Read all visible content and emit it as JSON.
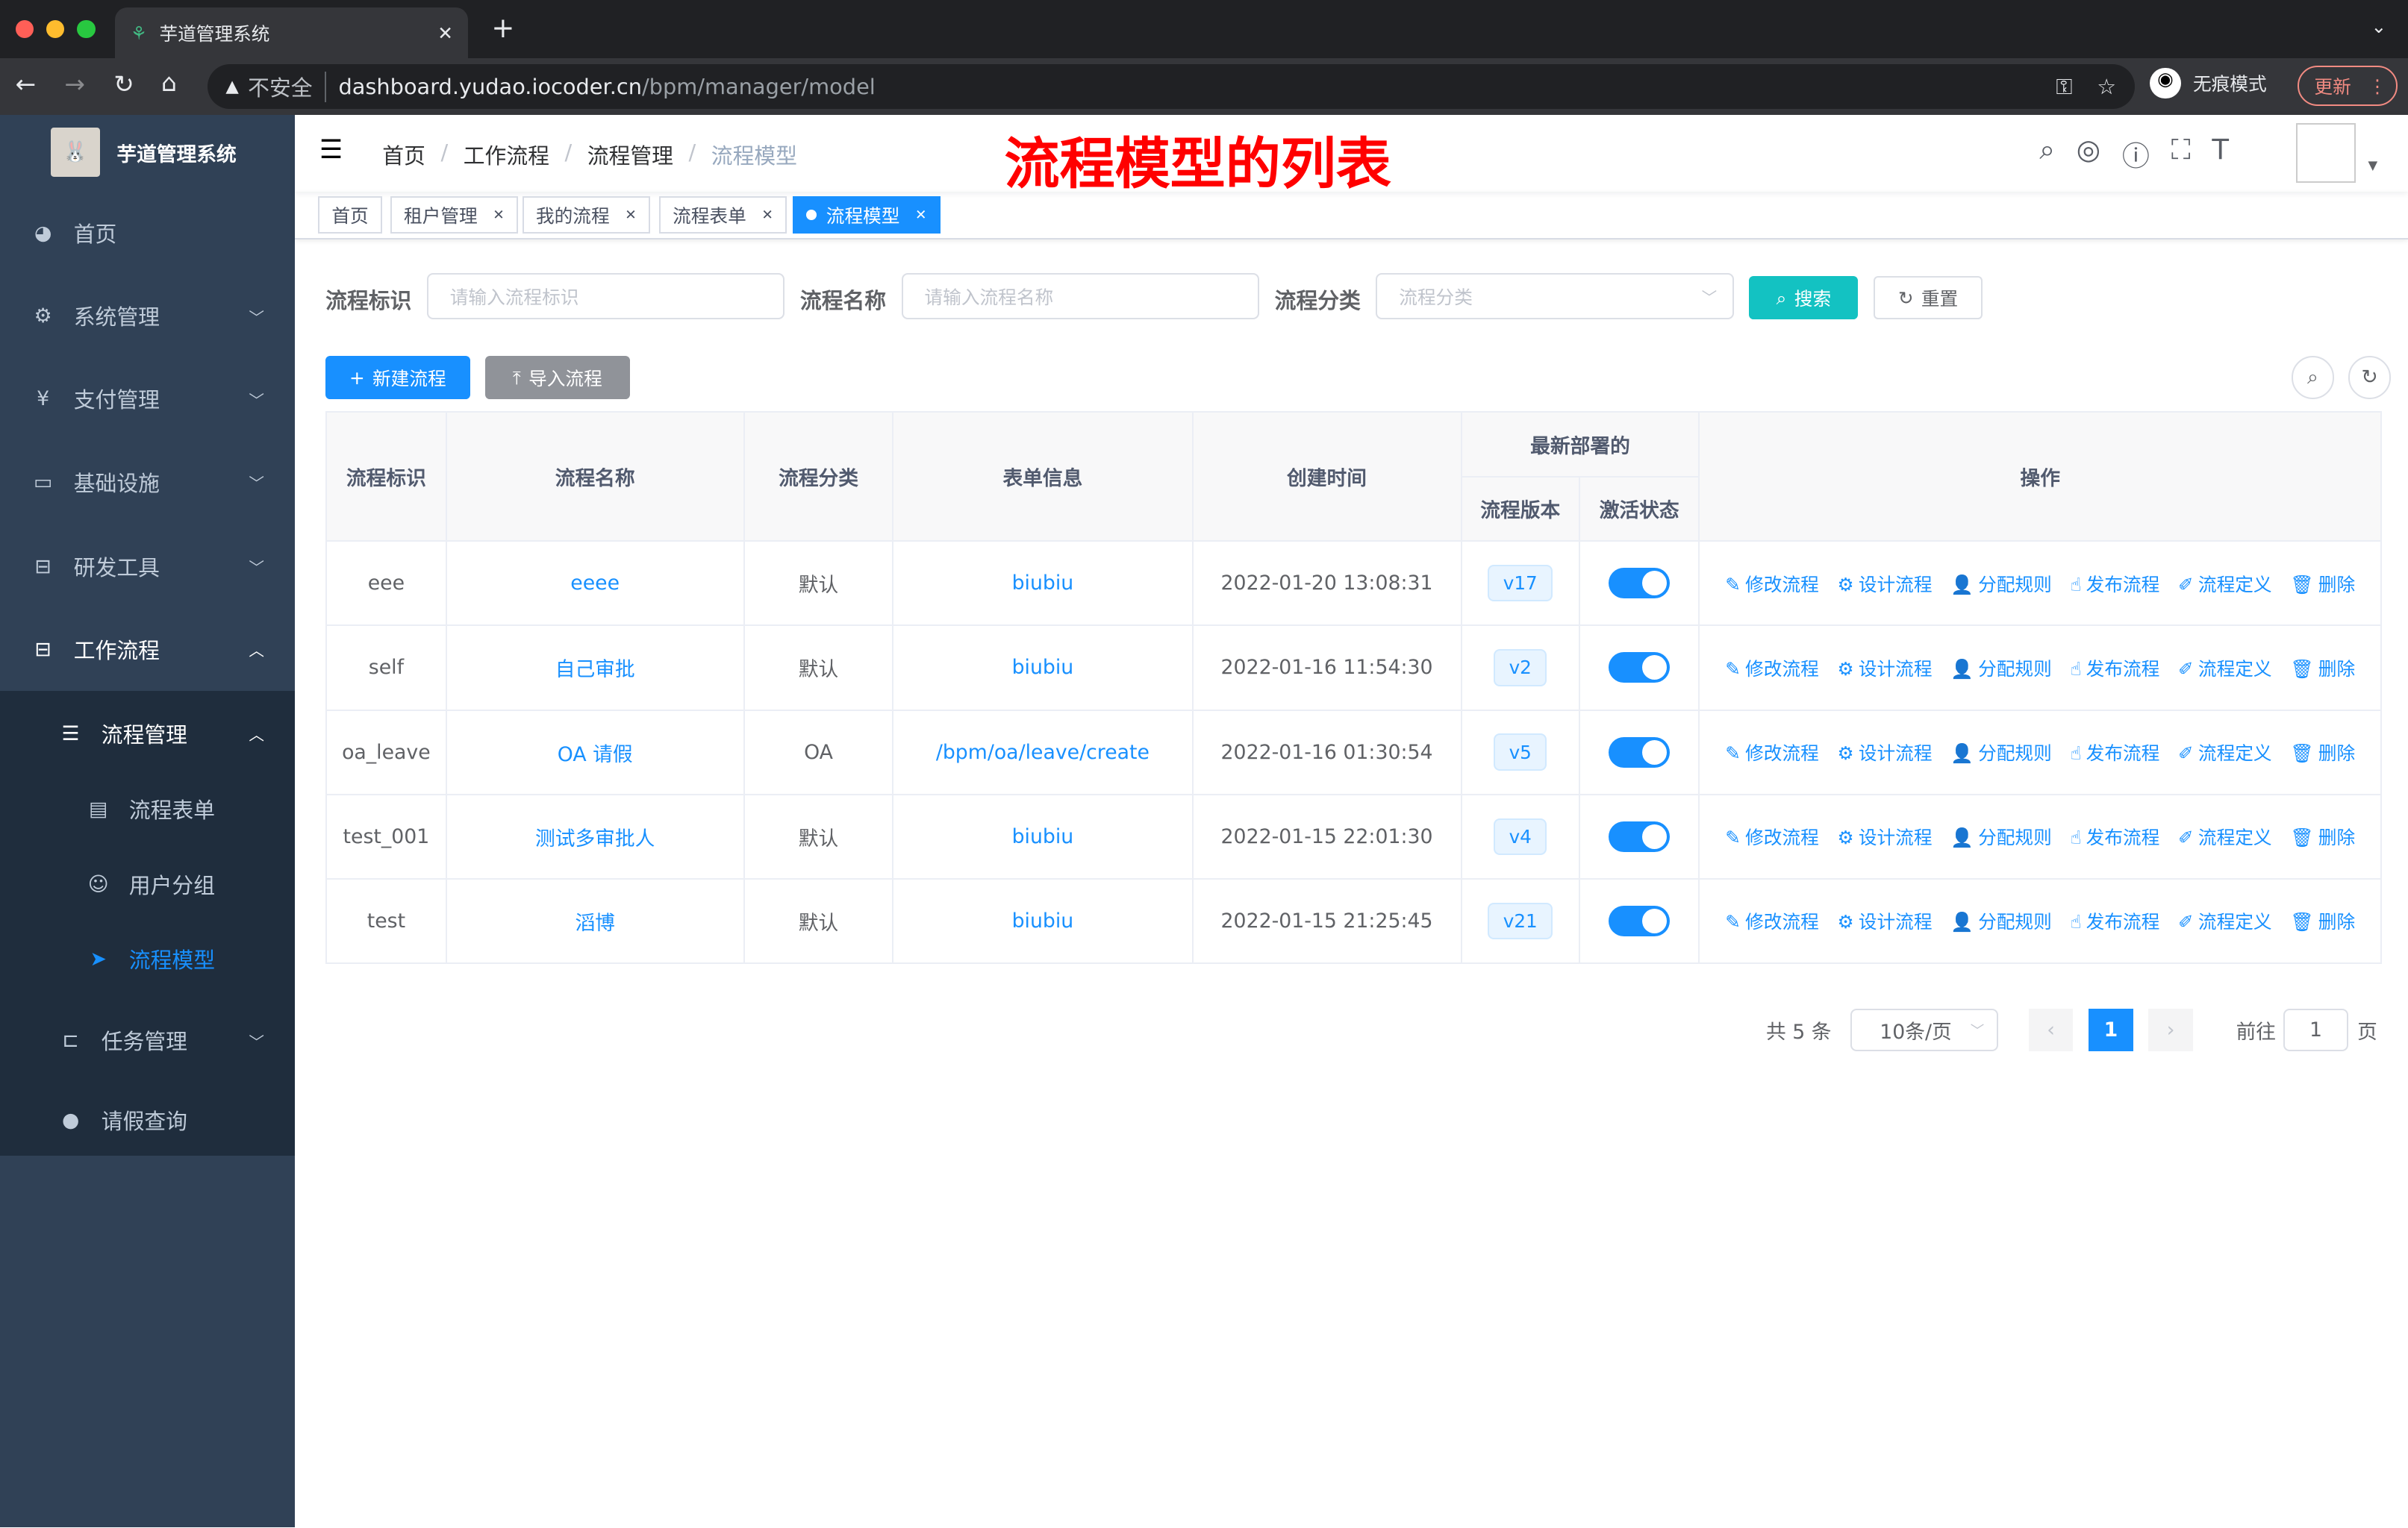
{
  "browser": {
    "tab_title": "芋道管理系统",
    "insecure": "不安全",
    "url_host": "dashboard.yudao.iocoder.cn",
    "url_path": "/bpm/manager/model",
    "incognito": "无痕模式",
    "update": "更新"
  },
  "sidebar": {
    "title": "芋道管理系统",
    "items": [
      {
        "label": "首页",
        "icon": "dashboard-icon"
      },
      {
        "label": "系统管理",
        "icon": "gear-icon"
      },
      {
        "label": "支付管理",
        "icon": "yen-icon"
      },
      {
        "label": "基础设施",
        "icon": "monitor-icon"
      },
      {
        "label": "研发工具",
        "icon": "toolbox-icon"
      },
      {
        "label": "工作流程",
        "icon": "toolbox-icon"
      },
      {
        "label": "流程管理",
        "icon": "list-icon"
      },
      {
        "label": "流程表单",
        "icon": "form-icon"
      },
      {
        "label": "用户分组",
        "icon": "group-icon"
      },
      {
        "label": "流程模型",
        "icon": "send-icon"
      },
      {
        "label": "任务管理",
        "icon": "task-icon"
      },
      {
        "label": "请假查询",
        "icon": "user-icon"
      }
    ]
  },
  "breadcrumb": [
    "首页",
    "工作流程",
    "流程管理",
    "流程模型"
  ],
  "annotation": "流程模型的列表",
  "tags": [
    "首页",
    "租户管理",
    "我的流程",
    "流程表单",
    "流程模型"
  ],
  "search": {
    "key_label": "流程标识",
    "key_placeholder": "请输入流程标识",
    "name_label": "流程名称",
    "name_placeholder": "请输入流程名称",
    "category_label": "流程分类",
    "category_placeholder": "流程分类",
    "search": "搜索",
    "reset": "重置"
  },
  "toolbar": {
    "create": "新建流程",
    "import": "导入流程"
  },
  "table": {
    "headers": {
      "key": "流程标识",
      "name": "流程名称",
      "category": "流程分类",
      "form": "表单信息",
      "created": "创建时间",
      "deploy": "最新部署的",
      "version": "流程版本",
      "status": "激活状态",
      "ops": "操作"
    },
    "ops": [
      "修改流程",
      "设计流程",
      "分配规则",
      "发布流程",
      "流程定义",
      "删除"
    ],
    "rows": [
      {
        "key": "eee",
        "name": "eeee",
        "category": "默认",
        "form": "biubiu",
        "created": "2022-01-20 13:08:31",
        "version": "v17",
        "active": true
      },
      {
        "key": "self",
        "name": "自己审批",
        "category": "默认",
        "form": "biubiu",
        "created": "2022-01-16 11:54:30",
        "version": "v2",
        "active": true
      },
      {
        "key": "oa_leave",
        "name": "OA 请假",
        "category": "OA",
        "form": "/bpm/oa/leave/create",
        "created": "2022-01-16 01:30:54",
        "version": "v5",
        "active": true
      },
      {
        "key": "test_001",
        "name": "测试多审批人",
        "category": "默认",
        "form": "biubiu",
        "created": "2022-01-15 22:01:30",
        "version": "v4",
        "active": true
      },
      {
        "key": "test",
        "name": "滔博",
        "category": "默认",
        "form": "biubiu",
        "created": "2022-01-15 21:25:45",
        "version": "v21",
        "active": true
      }
    ]
  },
  "pagination": {
    "total": "共 5 条",
    "size": "10条/页",
    "page": "1",
    "goto": "前往",
    "goto_value": "1",
    "unit": "页"
  },
  "colors": {
    "primary": "#1890ff",
    "sidebar": "#304156",
    "annotation": "#ff0000",
    "search_btn": "#13c2c2"
  }
}
